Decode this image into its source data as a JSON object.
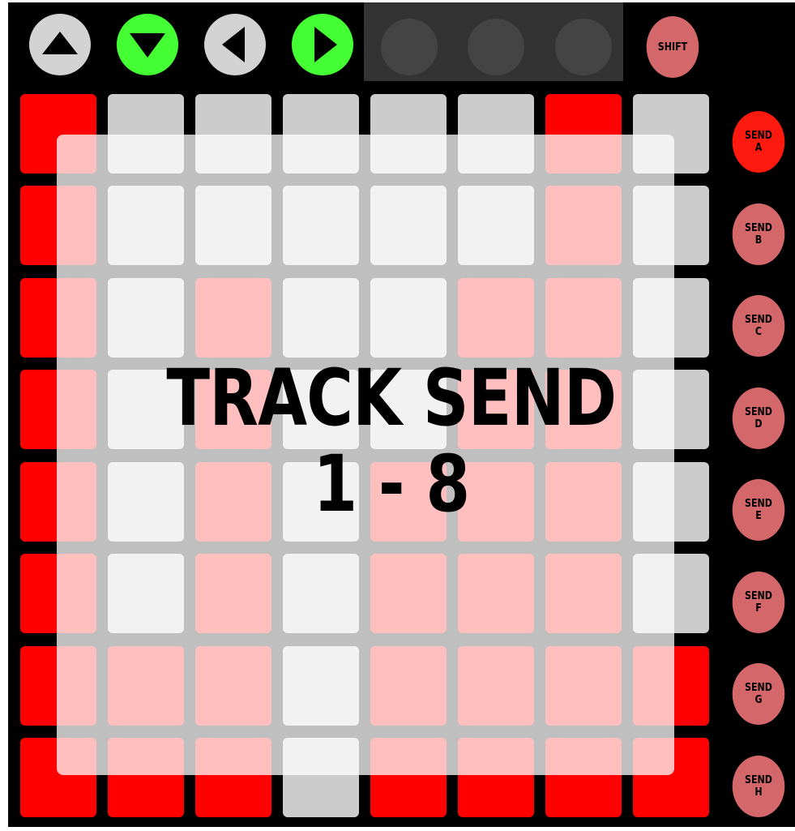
{
  "controller": {
    "top_buttons": [
      {
        "icon": "arrow-up-icon",
        "color": "#d3d3d3"
      },
      {
        "icon": "arrow-down-icon",
        "color": "#44ff33"
      },
      {
        "icon": "arrow-left-icon",
        "color": "#d3d3d3"
      },
      {
        "icon": "arrow-right-icon",
        "color": "#44ff33"
      }
    ],
    "shift_label": "SHIFT",
    "send_buttons": [
      {
        "line1": "SEND",
        "line2": "A",
        "color": "#ff1a0f"
      },
      {
        "line1": "SEND",
        "line2": "B",
        "color": "#d4676a"
      },
      {
        "line1": "SEND",
        "line2": "C",
        "color": "#d4676a"
      },
      {
        "line1": "SEND",
        "line2": "D",
        "color": "#d4676a"
      },
      {
        "line1": "SEND",
        "line2": "E",
        "color": "#d4676a"
      },
      {
        "line1": "SEND",
        "line2": "F",
        "color": "#d4676a"
      },
      {
        "line1": "SEND",
        "line2": "G",
        "color": "#d4676a"
      },
      {
        "line1": "SEND",
        "line2": "H",
        "color": "#d4676a"
      }
    ],
    "pad_grid": [
      [
        "red",
        "gray",
        "gray",
        "gray",
        "gray",
        "gray",
        "red",
        "gray"
      ],
      [
        "red",
        "gray",
        "gray",
        "gray",
        "gray",
        "gray",
        "red",
        "gray"
      ],
      [
        "red",
        "gray",
        "red",
        "gray",
        "gray",
        "red",
        "red",
        "gray"
      ],
      [
        "red",
        "gray",
        "red",
        "gray",
        "gray",
        "red",
        "red",
        "gray"
      ],
      [
        "red",
        "gray",
        "red",
        "gray",
        "red",
        "red",
        "red",
        "gray"
      ],
      [
        "red",
        "gray",
        "red",
        "gray",
        "red",
        "red",
        "red",
        "gray"
      ],
      [
        "red",
        "red",
        "red",
        "gray",
        "red",
        "red",
        "red",
        "red"
      ],
      [
        "red",
        "red",
        "red",
        "gray",
        "red",
        "red",
        "red",
        "red"
      ]
    ],
    "colors": {
      "red": "#ff0000",
      "gray": "#cccccc",
      "shift": "#d4676a",
      "bg": "#000000"
    }
  },
  "overlay": {
    "title_line1": "TRACK SEND",
    "title_line2": "1 - 8"
  }
}
